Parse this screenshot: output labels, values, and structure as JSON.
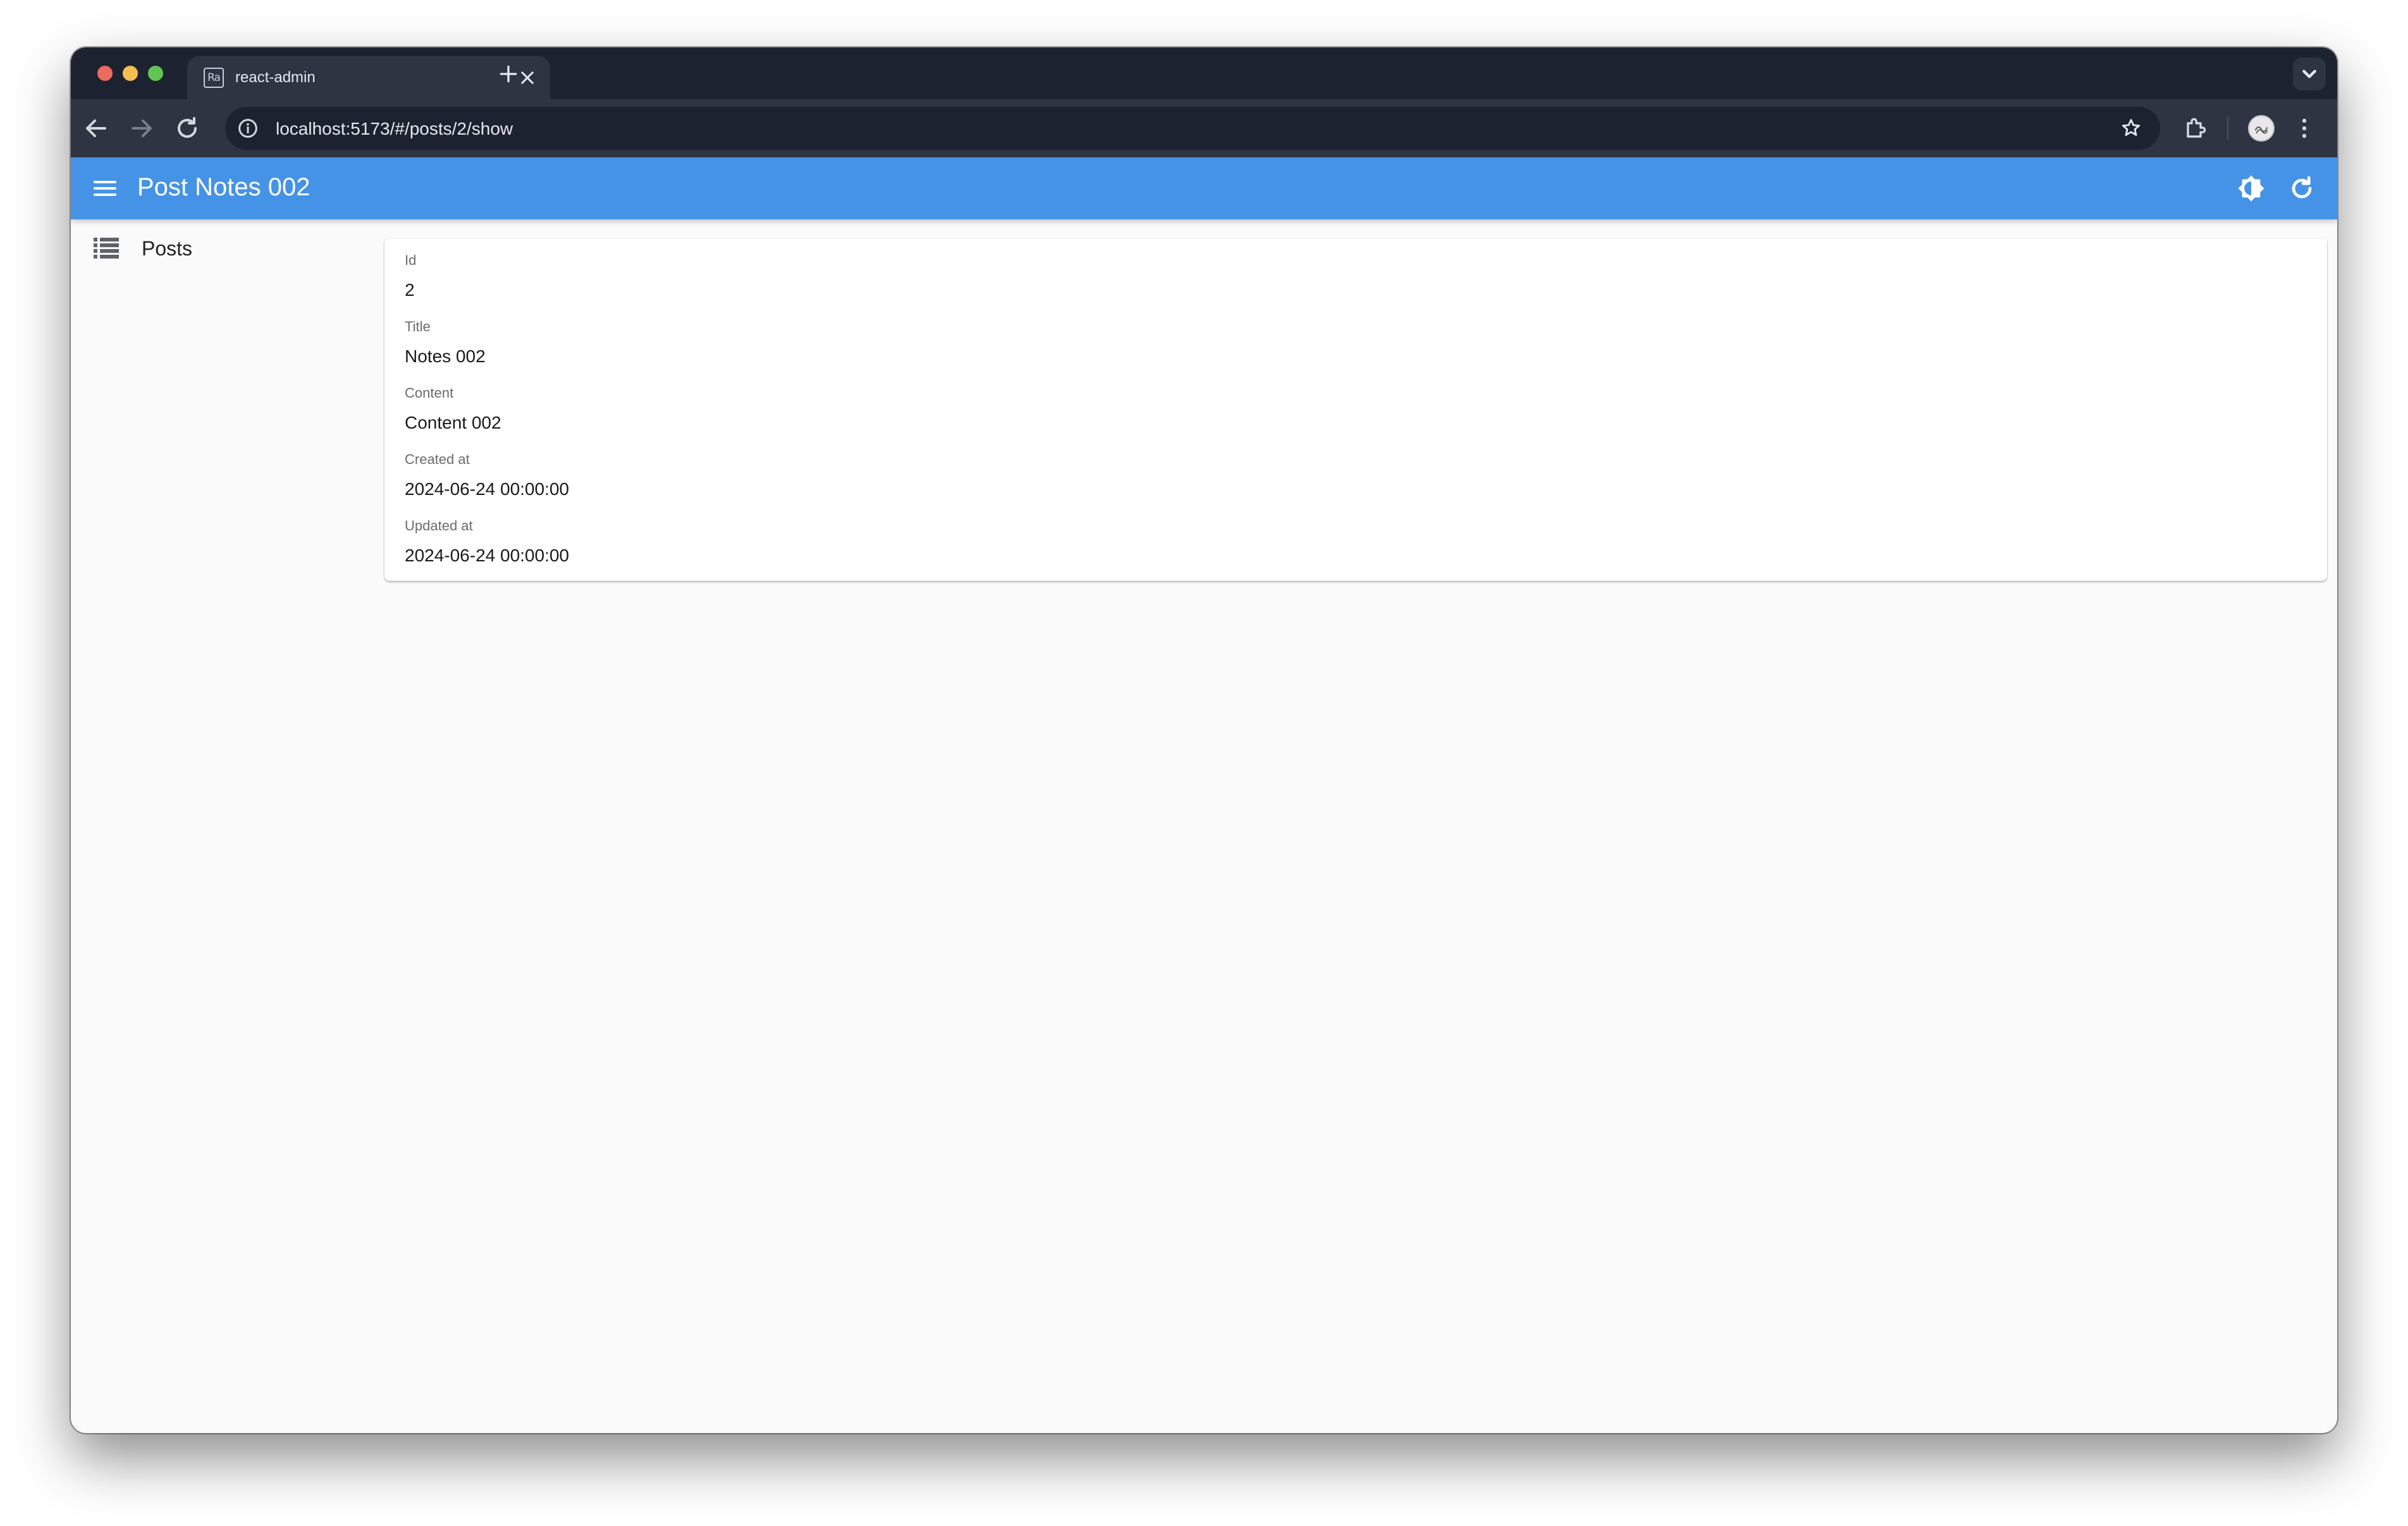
{
  "browser": {
    "tab": {
      "favicon_text": "Ra",
      "title": "react-admin"
    },
    "url": "localhost:5173/#/posts/2/show"
  },
  "app": {
    "title": "Post Notes 002",
    "colors": {
      "appbar": "#4593e6",
      "content_bg": "#fafafa"
    }
  },
  "sidebar": {
    "items": [
      {
        "label": "Posts",
        "icon": "list-icon"
      }
    ]
  },
  "record": {
    "fields": [
      {
        "label": "Id",
        "value": "2"
      },
      {
        "label": "Title",
        "value": "Notes 002"
      },
      {
        "label": "Content",
        "value": "Content 002"
      },
      {
        "label": "Created at",
        "value": "2024-06-24 00:00:00"
      },
      {
        "label": "Updated at",
        "value": "2024-06-24 00:00:00"
      }
    ]
  }
}
